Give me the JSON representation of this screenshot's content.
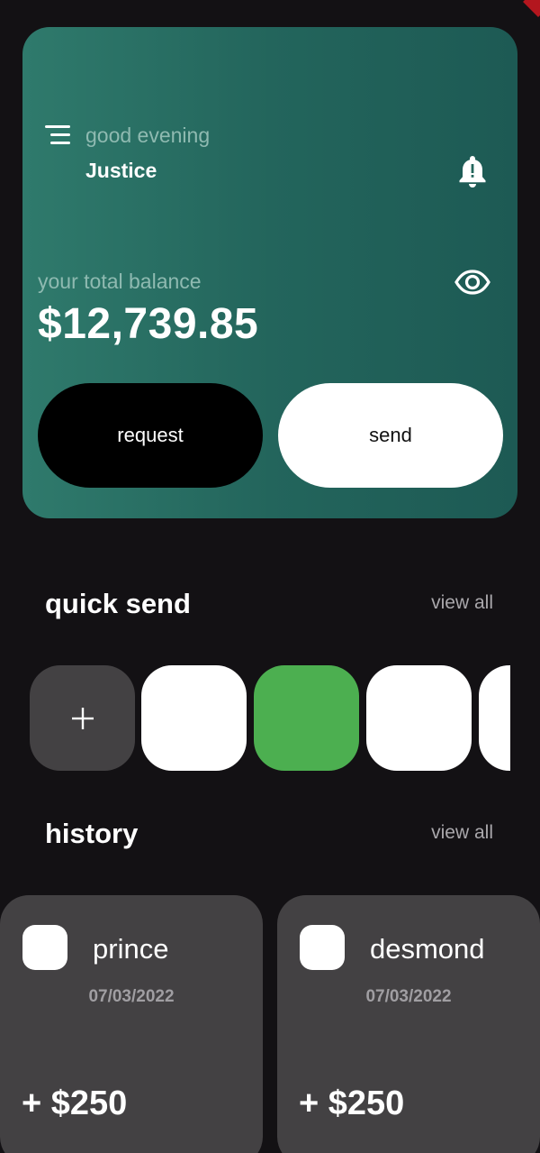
{
  "header": {
    "greeting": "good evening",
    "user_name": "Justice",
    "menu_icon": "menu-icon",
    "notification_icon": "bell-icon"
  },
  "balance": {
    "label": "your total balance",
    "amount": "$12,739.85",
    "visibility_icon": "eye-icon"
  },
  "actions": {
    "request_label": "request",
    "send_label": "send"
  },
  "quick_send": {
    "title": "quick send",
    "view_all_label": "view all",
    "add_label": "+",
    "contacts": [
      {
        "color": "#ffffff"
      },
      {
        "color": "#4caf50"
      },
      {
        "color": "#ffffff"
      },
      {
        "color": "#ffffff"
      }
    ]
  },
  "history": {
    "title": "history",
    "view_all_label": "view all",
    "items": [
      {
        "name": "prince",
        "date": "07/03/2022",
        "amount": "+ $250"
      },
      {
        "name": "desmond",
        "date": "07/03/2022",
        "amount": "+ $250"
      }
    ]
  },
  "colors": {
    "background": "#131114",
    "card_gradient_start": "#2f7a6c",
    "card_gradient_end": "#1d5a54",
    "muted_text": "#8fbab1",
    "tile": "#434143",
    "accent_green": "#4caf50"
  }
}
